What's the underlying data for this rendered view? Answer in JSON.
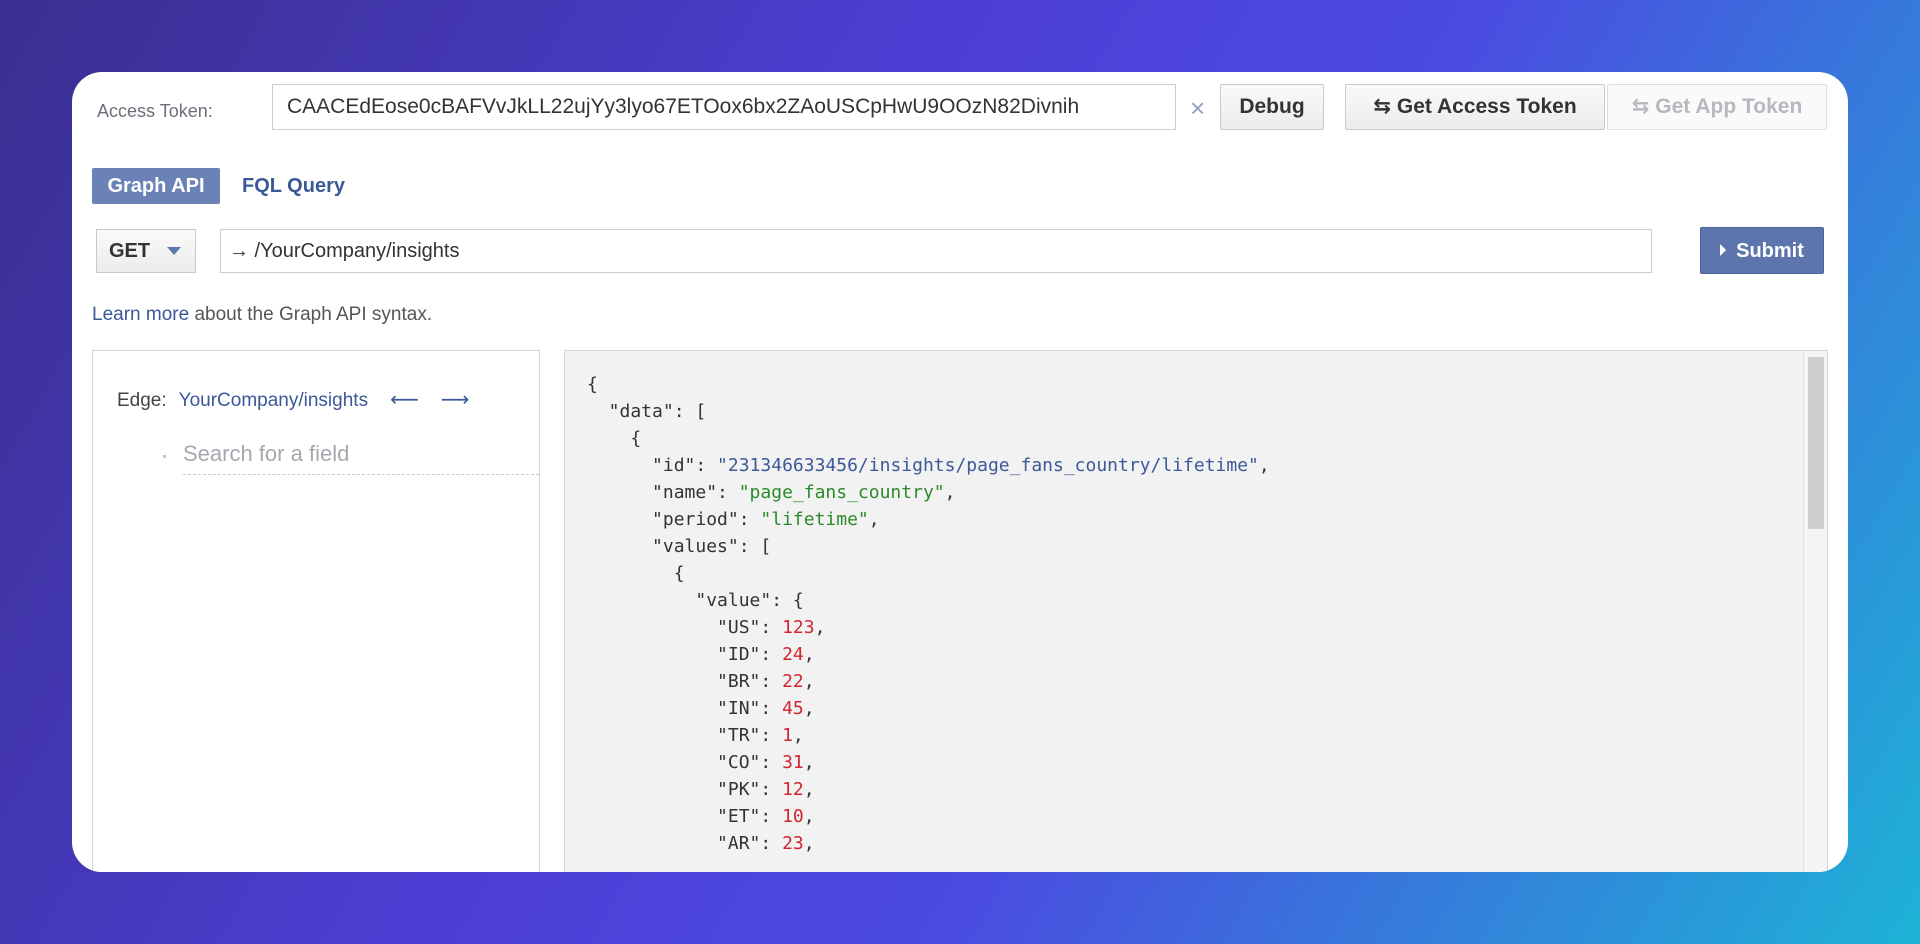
{
  "token": {
    "label": "Access Token:",
    "value": "CAACEdEose0cBAFVvJkLL22ujYy3lyo67ETOox6bx2ZAoUSCpHwU9OOzN82Divnih",
    "clear_icon": "×",
    "debug_label": "Debug",
    "get_access_label": "Get Access Token",
    "get_app_label": "Get App Token",
    "swap_icon": "⇆"
  },
  "tabs": {
    "graph": "Graph API",
    "fql": "FQL Query"
  },
  "query": {
    "method": "GET",
    "path": "→ /YourCompany/insights",
    "submit": "Submit"
  },
  "learn": {
    "link": "Learn more",
    "rest": " about the Graph API syntax."
  },
  "edge": {
    "label": "Edge:",
    "value": "YourCompany/insights",
    "back": "⟵",
    "forward": "⟶",
    "search_placeholder": "Search for a field"
  },
  "response": {
    "id": "231346633456/insights/page_fans_country/lifetime",
    "name": "page_fans_country",
    "period": "lifetime",
    "values": [
      {
        "code": "US",
        "count": "123"
      },
      {
        "code": "ID",
        "count": "24"
      },
      {
        "code": "BR",
        "count": "22"
      },
      {
        "code": "IN",
        "count": "45"
      },
      {
        "code": "TR",
        "count": "1"
      },
      {
        "code": "CO",
        "count": "31"
      },
      {
        "code": "PK",
        "count": "12"
      },
      {
        "code": "ET",
        "count": "10"
      },
      {
        "code": "AR",
        "count": "23"
      }
    ]
  }
}
